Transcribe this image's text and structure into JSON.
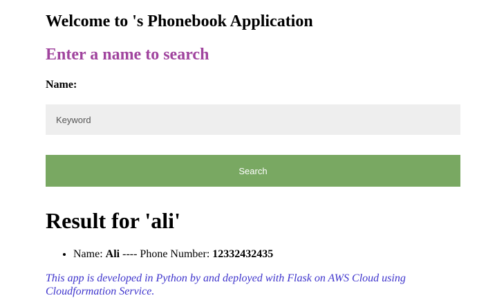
{
  "header": {
    "title": "Welcome to 's Phonebook Application",
    "subtitle": "Enter a name to search"
  },
  "form": {
    "name_label": "Name:",
    "keyword_placeholder": "Keyword",
    "keyword_value": "",
    "search_label": "Search"
  },
  "result": {
    "heading": "Result for 'ali'",
    "items": [
      {
        "name_prefix": "Name: ",
        "name": "Ali",
        "separator": " ---- Phone Number: ",
        "phone": "12332432435"
      }
    ]
  },
  "footer": {
    "note": "This app is developed in Python by and deployed with Flask on AWS Cloud using Cloudformation Service."
  },
  "colors": {
    "subtitle": "#a0449e",
    "search_button": "#79a862",
    "input_background": "#eeeeee",
    "footer_text": "#3d33cc"
  }
}
